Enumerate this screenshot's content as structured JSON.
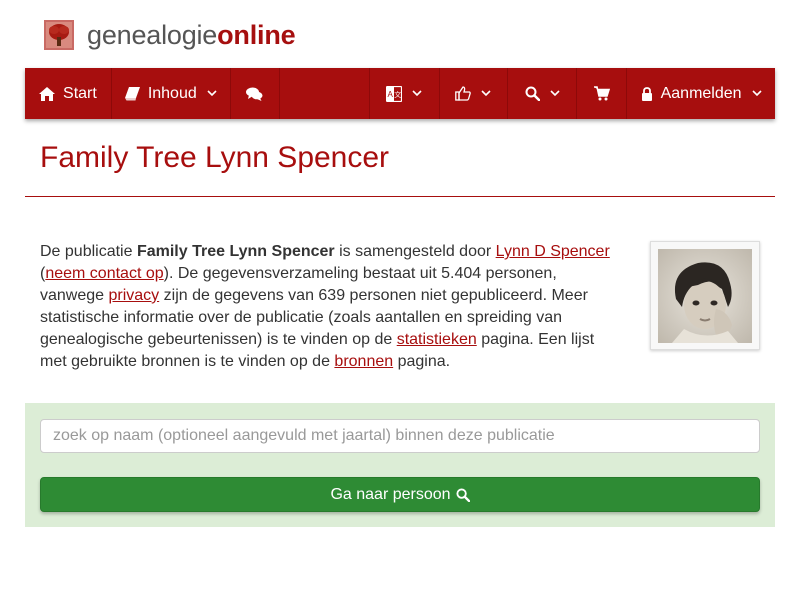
{
  "logo": {
    "part1": "genealogie",
    "part2": "online",
    "icon": "tree-icon"
  },
  "nav": {
    "items": [
      {
        "label": "Start",
        "icon": "home-icon"
      },
      {
        "label": "Inhoud",
        "icon": "book-icon"
      },
      {
        "label": "",
        "icon": "comments-icon"
      },
      {
        "label": "",
        "icon": "translate-icon"
      },
      {
        "label": "",
        "icon": "thumbs-up-icon"
      },
      {
        "label": "",
        "icon": "search-icon"
      },
      {
        "label": "",
        "icon": "cart-icon"
      },
      {
        "label": "Aanmelden",
        "icon": "lock-icon"
      }
    ]
  },
  "page": {
    "title": "Family Tree Lynn Spencer"
  },
  "intro": {
    "t1": "De publicatie ",
    "pub_name": "Family Tree Lynn Spencer",
    "t2": " is samengesteld door ",
    "author_link": "Lynn D Spencer",
    "t3": "(",
    "contact_link": "neem contact op",
    "t4": "). De gegevensverzameling bestaat uit 5.404 personen, vanwege ",
    "privacy_link": "privacy",
    "t5": " zijn de gegevens van 639 personen niet gepubliceerd. Meer statistische informatie over de publicatie (zoals aantallen en spreiding van genealogische gebeurtenissen) is te vinden op de ",
    "stats_link": "statistieken",
    "t6": " pagina. Een lijst met gebruikte bronnen is te vinden op de ",
    "sources_link": "bronnen",
    "t7": " pagina."
  },
  "search": {
    "placeholder": "zoek op naam (optioneel aangevuld met jaartal) binnen deze publicatie",
    "button_label": "Ga naar persoon",
    "button_icon": "search-icon"
  },
  "colors": {
    "brand": "#a70e0e",
    "panel": "#dcedd6",
    "button": "#2e8b34"
  }
}
